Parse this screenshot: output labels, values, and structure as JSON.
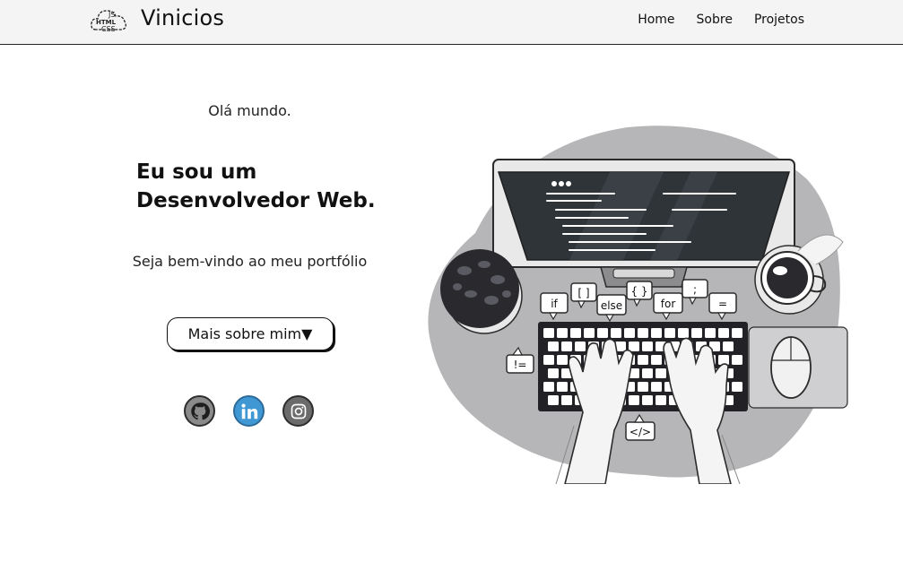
{
  "navbar": {
    "logo_icon": "js-html-css-cloud-icon",
    "logo_text": {
      "js": "JS",
      "html": "HTML",
      "css": "CSS"
    },
    "brand": "Vinicios",
    "links": [
      "Home",
      "Sobre",
      "Projetos"
    ]
  },
  "hero": {
    "greeting": "Olá mundo.",
    "headline_line1": "Eu sou um",
    "headline_line2": "Desenvolvedor Web.",
    "welcome": "Seja bem-vindo ao meu portfólio",
    "button_label": "Mais sobre mim▼"
  },
  "socials": [
    {
      "name": "github",
      "icon": "github-icon",
      "color": "#8a8a8a"
    },
    {
      "name": "linkedin",
      "icon": "linkedin-icon",
      "color": "#3f97d3"
    },
    {
      "name": "instagram",
      "icon": "instagram-icon",
      "color": "#6b6b6b"
    }
  ],
  "illustration": {
    "bubbles": [
      "if",
      "[ ]",
      "else",
      "{ }",
      "for",
      ";",
      "=",
      "!=",
      "</>"
    ]
  }
}
